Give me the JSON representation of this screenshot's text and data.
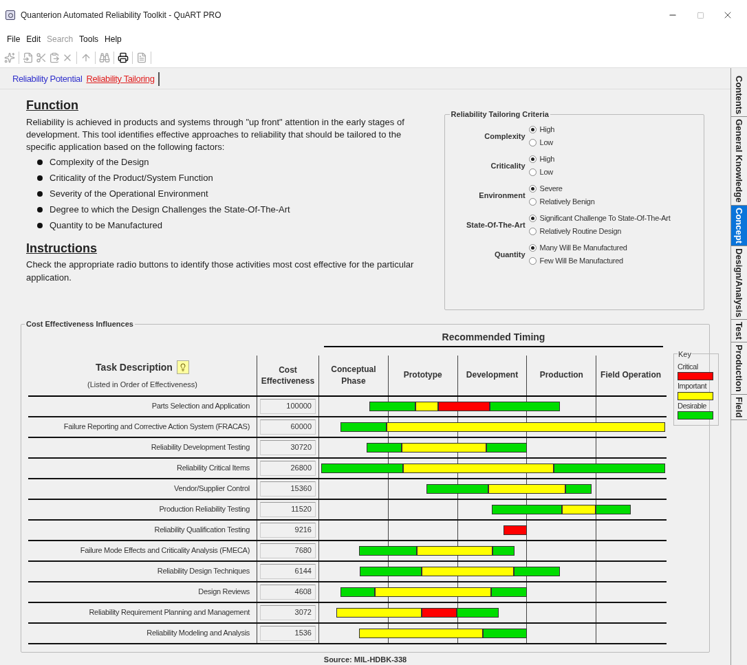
{
  "window": {
    "title": "Quanterion Automated Reliability Toolkit - QuART PRO"
  },
  "menu": [
    {
      "label": "File",
      "disabled": false
    },
    {
      "label": "Edit",
      "disabled": false
    },
    {
      "label": "Search",
      "disabled": true
    },
    {
      "label": "Tools",
      "disabled": false
    },
    {
      "label": "Help",
      "disabled": false
    }
  ],
  "page_tabs": [
    {
      "label": "Reliability Potential",
      "selected": false
    },
    {
      "label": "Reliability Tailoring",
      "selected": true
    }
  ],
  "side_tabs": [
    {
      "label": "Contents",
      "selected": false
    },
    {
      "label": "General Knowledge",
      "selected": false
    },
    {
      "label": "Concept",
      "selected": true
    },
    {
      "label": "Design/Analysis",
      "selected": false
    },
    {
      "label": "Test",
      "selected": false
    },
    {
      "label": "Production",
      "selected": false
    },
    {
      "label": "Field",
      "selected": false
    }
  ],
  "function": {
    "heading": "Function",
    "text": "Reliability is achieved in products and systems through \"up front\" attention in the early stages of development. This tool identifies effective approaches to reliability that should be tailored to the specific application based on the following factors:",
    "bullets": [
      "Complexity of the Design",
      "Criticality of the Product/System Function",
      "Severity of the Operational Environment",
      "Degree to which the Design Challenges the State-Of-The-Art",
      "Quantity to be Manufactured"
    ]
  },
  "instructions": {
    "heading": "Instructions",
    "text": "Check the appropriate radio buttons to identify those activities most cost effective for the particular application."
  },
  "criteria": {
    "title": "Reliability Tailoring Criteria",
    "groups": [
      {
        "label": "Complexity",
        "options": [
          {
            "label": "High",
            "selected": true
          },
          {
            "label": "Low",
            "selected": false
          }
        ]
      },
      {
        "label": "Criticality",
        "options": [
          {
            "label": "High",
            "selected": true
          },
          {
            "label": "Low",
            "selected": false
          }
        ]
      },
      {
        "label": "Environment",
        "options": [
          {
            "label": "Severe",
            "selected": true
          },
          {
            "label": "Relatively Benign",
            "selected": false
          }
        ]
      },
      {
        "label": "State-Of-The-Art",
        "options": [
          {
            "label": "Significant Challenge To State-Of-The-Art",
            "selected": true
          },
          {
            "label": "Relatively Routine Design",
            "selected": false
          }
        ]
      },
      {
        "label": "Quantity",
        "options": [
          {
            "label": "Many Will Be Manufactured",
            "selected": true
          },
          {
            "label": "Few Will Be Manufactured",
            "selected": false
          }
        ]
      }
    ]
  },
  "influences": {
    "title": "Cost Effectiveness Influences",
    "timing_heading": "Recommended Timing",
    "task_heading": "Task Description",
    "task_note": "(Listed in Order of Effectiveness)",
    "cost_heading": "Cost Effectiveness",
    "phases": [
      "Conceptual Phase",
      "Prototype",
      "Development",
      "Production",
      "Field Operation"
    ],
    "rows": [
      {
        "task": "Parts Selection and Application",
        "cost": "100000",
        "segments": [
          {
            "kind": "desirable"
          },
          {
            "kind": "important"
          },
          {
            "kind": "critical"
          },
          {
            "kind": "desirable"
          }
        ]
      },
      {
        "task": "Failure Reporting and Corrective Action System (FRACAS)",
        "cost": "60000",
        "segments": [
          {
            "kind": "desirable"
          },
          {
            "kind": "important"
          }
        ]
      },
      {
        "task": "Reliability Development Testing",
        "cost": "30720",
        "segments": [
          {
            "kind": "desirable"
          },
          {
            "kind": "important"
          },
          {
            "kind": "desirable"
          }
        ]
      },
      {
        "task": "Reliability Critical Items",
        "cost": "26800",
        "segments": [
          {
            "kind": "desirable"
          },
          {
            "kind": "important"
          },
          {
            "kind": "desirable"
          }
        ]
      },
      {
        "task": "Vendor/Supplier Control",
        "cost": "15360",
        "segments": [
          {
            "kind": "desirable"
          },
          {
            "kind": "important"
          },
          {
            "kind": "desirable"
          }
        ]
      },
      {
        "task": "Production Reliability Testing",
        "cost": "11520",
        "segments": [
          {
            "kind": "desirable"
          },
          {
            "kind": "important"
          },
          {
            "kind": "desirable"
          }
        ]
      },
      {
        "task": "Reliability Qualification Testing",
        "cost": "9216",
        "segments": [
          {
            "kind": "critical"
          }
        ]
      },
      {
        "task": "Failure Mode Effects and Criticality Analysis (FMECA)",
        "cost": "7680",
        "segments": [
          {
            "kind": "desirable"
          },
          {
            "kind": "important"
          },
          {
            "kind": "desirable"
          }
        ]
      },
      {
        "task": "Reliability Design Techniques",
        "cost": "6144",
        "segments": [
          {
            "kind": "desirable"
          },
          {
            "kind": "important"
          },
          {
            "kind": "desirable"
          }
        ]
      },
      {
        "task": "Design Reviews",
        "cost": "4608",
        "segments": [
          {
            "kind": "desirable"
          },
          {
            "kind": "important"
          },
          {
            "kind": "desirable"
          }
        ]
      },
      {
        "task": "Reliability Requirement Planning and Management",
        "cost": "3072",
        "segments": [
          {
            "kind": "important"
          },
          {
            "kind": "critical"
          },
          {
            "kind": "desirable"
          }
        ]
      },
      {
        "task": "Reliability Modeling and Analysis",
        "cost": "1536",
        "segments": [
          {
            "kind": "important"
          },
          {
            "kind": "desirable"
          }
        ]
      }
    ],
    "key": {
      "title": "Key",
      "items": [
        {
          "label": "Critical",
          "kind": "critical",
          "color": "#ff0000"
        },
        {
          "label": "Important",
          "kind": "important",
          "color": "#ffff00"
        },
        {
          "label": "Desirable",
          "kind": "desirable",
          "color": "#00dd00"
        }
      ]
    },
    "source": "Source: MIL-HDBK-338"
  }
}
